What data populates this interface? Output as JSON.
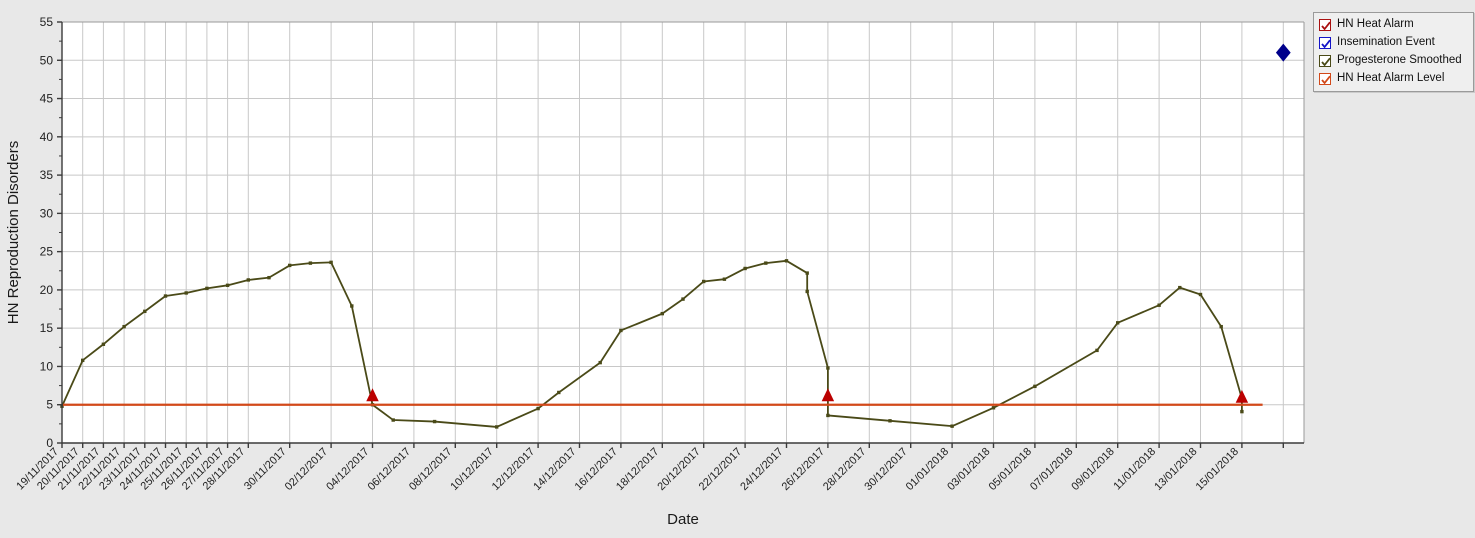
{
  "chart_data": {
    "type": "line",
    "title": "",
    "xlabel": "Date",
    "ylabel": "HN Reproduction Disorders",
    "ylim": [
      0,
      55
    ],
    "ytick_step": 5,
    "yticks": [
      0,
      5,
      10,
      15,
      20,
      25,
      30,
      35,
      40,
      45,
      50,
      55
    ],
    "grid": true,
    "legend_position": "top-right",
    "xlim": [
      "19/11/2017",
      "18/01/2018"
    ],
    "xtick_labels": [
      "19/11/2017",
      "20/11/2017",
      "21/11/2017",
      "22/11/2017",
      "23/11/2017",
      "24/11/2017",
      "25/11/2017",
      "26/11/2017",
      "27/11/2017",
      "28/11/2017",
      "30/11/2017",
      "02/12/2017",
      "04/12/2017",
      "06/12/2017",
      "08/12/2017",
      "10/12/2017",
      "12/12/2017",
      "14/12/2017",
      "16/12/2017",
      "18/12/2017",
      "20/12/2017",
      "22/12/2017",
      "24/12/2017",
      "26/12/2017",
      "28/12/2017",
      "30/12/2017",
      "01/01/2018",
      "03/01/2018",
      "05/01/2018",
      "07/01/2018",
      "09/01/2018",
      "11/01/2018",
      "13/01/2018",
      "15/01/2018"
    ],
    "series": [
      {
        "name": "Progesterone Smoothed",
        "type": "line",
        "color": "#4a4a18",
        "marker": "square",
        "points": [
          {
            "x": "19/11/2017",
            "y": 4.8
          },
          {
            "x": "20/11/2017",
            "y": 10.8
          },
          {
            "x": "21/11/2017",
            "y": 12.9
          },
          {
            "x": "22/11/2017",
            "y": 15.2
          },
          {
            "x": "23/11/2017",
            "y": 17.2
          },
          {
            "x": "24/11/2017",
            "y": 19.2
          },
          {
            "x": "25/11/2017",
            "y": 19.6
          },
          {
            "x": "26/11/2017",
            "y": 20.2
          },
          {
            "x": "27/11/2017",
            "y": 20.6
          },
          {
            "x": "28/11/2017",
            "y": 21.3
          },
          {
            "x": "29/11/2017",
            "y": 21.6
          },
          {
            "x": "30/11/2017",
            "y": 23.2
          },
          {
            "x": "01/12/2017",
            "y": 23.5
          },
          {
            "x": "02/12/2017",
            "y": 23.6
          },
          {
            "x": "03/12/2017",
            "y": 17.9
          },
          {
            "x": "04/12/2017",
            "y": 5.0
          },
          {
            "x": "05/12/2017",
            "y": 3.0
          },
          {
            "x": "07/12/2017",
            "y": 2.8
          },
          {
            "x": "10/12/2017",
            "y": 2.1
          },
          {
            "x": "12/12/2017",
            "y": 4.5
          },
          {
            "x": "13/12/2017",
            "y": 6.6
          },
          {
            "x": "15/12/2017",
            "y": 10.5
          },
          {
            "x": "16/12/2017",
            "y": 14.7
          },
          {
            "x": "18/12/2017",
            "y": 16.9
          },
          {
            "x": "19/12/2017",
            "y": 18.8
          },
          {
            "x": "20/12/2017",
            "y": 21.1
          },
          {
            "x": "21/12/2017",
            "y": 21.4
          },
          {
            "x": "22/12/2017",
            "y": 22.8
          },
          {
            "x": "23/12/2017",
            "y": 23.5
          },
          {
            "x": "24/12/2017",
            "y": 23.8
          },
          {
            "x": "25/12/2017",
            "y": 22.2
          },
          {
            "x": "25/12/2017b",
            "y": 19.8
          },
          {
            "x": "26/12/2017",
            "y": 9.8
          },
          {
            "x": "26/12/2017b",
            "y": 3.6
          },
          {
            "x": "29/12/2017",
            "y": 2.9
          },
          {
            "x": "01/01/2018",
            "y": 2.2
          },
          {
            "x": "03/01/2018",
            "y": 4.6
          },
          {
            "x": "05/01/2018",
            "y": 7.4
          },
          {
            "x": "08/01/2018",
            "y": 12.1
          },
          {
            "x": "09/01/2018",
            "y": 15.7
          },
          {
            "x": "11/01/2018",
            "y": 18.0
          },
          {
            "x": "12/01/2018",
            "y": 20.3
          },
          {
            "x": "13/01/2018",
            "y": 19.4
          },
          {
            "x": "14/01/2018",
            "y": 15.2
          },
          {
            "x": "15/01/2018",
            "y": 5.8
          },
          {
            "x": "15/01/2018b",
            "y": 4.1
          }
        ]
      },
      {
        "name": "HN Heat Alarm Level",
        "type": "hline",
        "color": "#d2491a",
        "value": 5
      },
      {
        "name": "HN Heat Alarm",
        "type": "marker",
        "marker": "triangle",
        "color": "#bb0000",
        "points": [
          {
            "x": "04/12/2017",
            "y": 6.1
          },
          {
            "x": "26/12/2017",
            "y": 6.1
          },
          {
            "x": "15/01/2018",
            "y": 5.9
          }
        ]
      },
      {
        "name": "Insemination Event",
        "type": "marker",
        "marker": "diamond",
        "color": "#00008b",
        "points": [
          {
            "x": "17/01/2018",
            "y": 51.0
          }
        ]
      }
    ]
  },
  "legend": {
    "items": [
      {
        "label": "HN Heat Alarm",
        "color": "#aa1111",
        "checked": true
      },
      {
        "label": "Insemination Event",
        "color": "#1414c8",
        "checked": true
      },
      {
        "label": "Progesterone Smoothed",
        "color": "#4a4a18",
        "checked": true
      },
      {
        "label": "HN Heat Alarm Level",
        "color": "#d2491a",
        "checked": true
      }
    ]
  }
}
